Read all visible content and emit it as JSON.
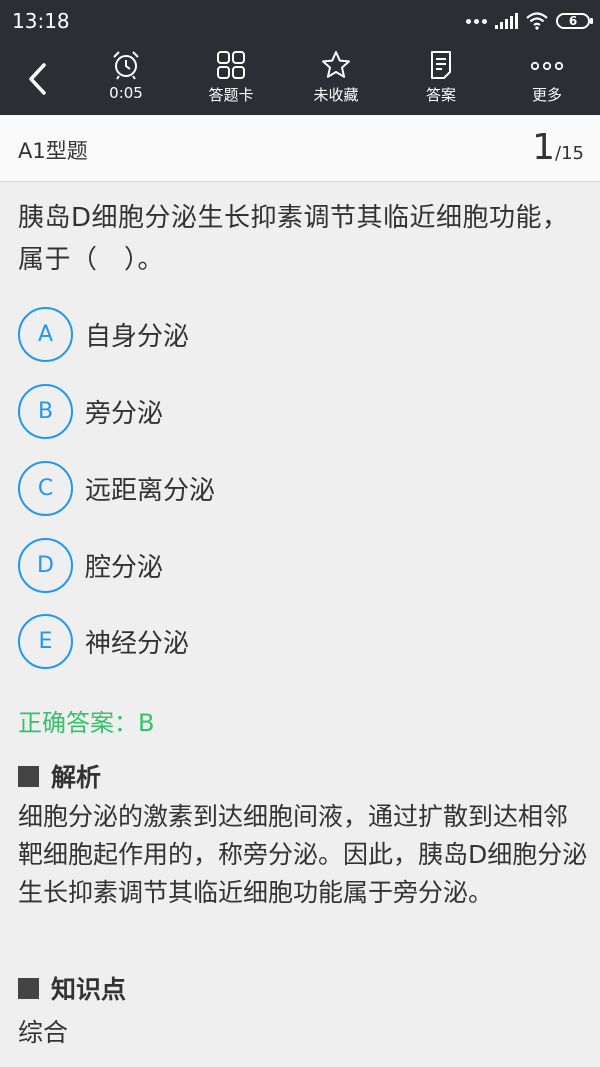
{
  "status_bar": {
    "time": "13:18",
    "battery": "6"
  },
  "toolbar": {
    "timer": "0:05",
    "answer_card": "答题卡",
    "favorite": "未收藏",
    "answer": "答案",
    "more": "更多"
  },
  "header": {
    "question_type": "A1型题",
    "current": "1",
    "total": "/15"
  },
  "question": {
    "text": "胰岛D细胞分泌生长抑素调节其临近细胞功能，属于（　）。",
    "options": [
      {
        "letter": "A",
        "text": "自身分泌"
      },
      {
        "letter": "B",
        "text": "旁分泌"
      },
      {
        "letter": "C",
        "text": "远距离分泌"
      },
      {
        "letter": "D",
        "text": "腔分泌"
      },
      {
        "letter": "E",
        "text": "神经分泌"
      }
    ]
  },
  "correct_answer": "正确答案：B",
  "analysis": {
    "title": "解析",
    "text": "细胞分泌的激素到达细胞间液，通过扩散到达相邻靶细胞起作用的，称旁分泌。因此，胰岛D细胞分泌生长抑素调节其临近细胞功能属于旁分泌。"
  },
  "knowledge": {
    "title": "知识点",
    "text": "综合"
  },
  "colors": {
    "topbar": "#2b2e33",
    "accent": "#2196f3",
    "correct": "#35c26a",
    "background": "#efefef"
  }
}
